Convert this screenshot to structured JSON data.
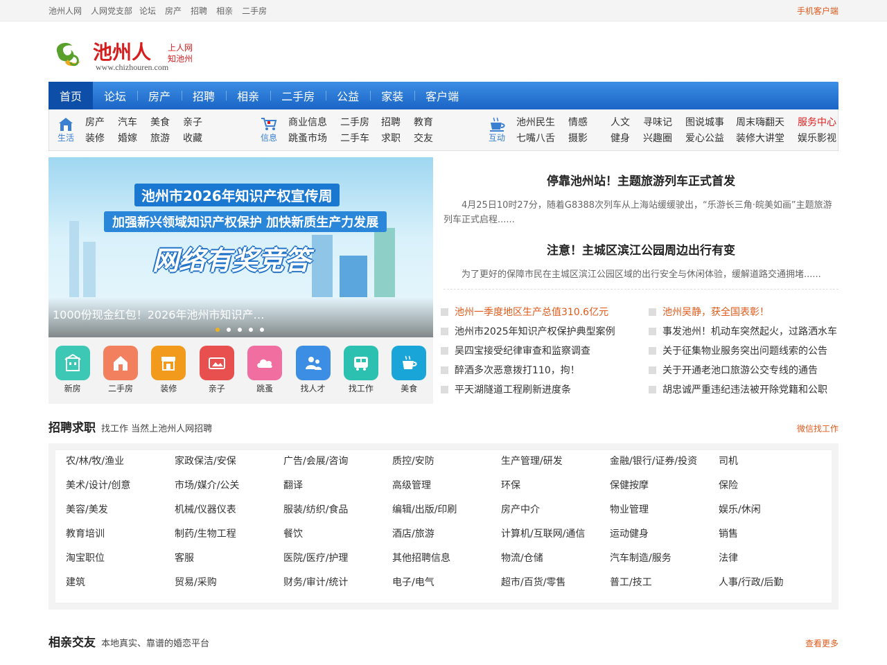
{
  "topbar": {
    "links": [
      "池州人网",
      "人网党支部",
      "论坛",
      "房产",
      "招聘",
      "相亲",
      "二手房"
    ],
    "right": "手机客户端"
  },
  "logo": {
    "name": "池州人",
    "slogan1": "上人网",
    "slogan2": "知池州",
    "url": "www.chizhouren.com"
  },
  "nav": [
    "首页",
    "论坛",
    "房产",
    "招聘",
    "相亲",
    "二手房",
    "公益",
    "家装",
    "客户端"
  ],
  "subnav": {
    "life": {
      "label": "生活",
      "items": [
        "房产",
        "汽车",
        "美食",
        "亲子",
        "装修",
        "婚嫁",
        "旅游",
        "收藏"
      ]
    },
    "info": {
      "label": "信息",
      "items": [
        "商业信息",
        "二手房",
        "招聘",
        "教育",
        "跳蚤市场",
        "二手车",
        "求职",
        "交友"
      ]
    },
    "interact": {
      "label": "互动",
      "items": [
        "池州民生",
        "情感",
        "人文",
        "寻味记",
        "图说城事",
        "周末嗨翻天",
        "服务中心",
        "七嘴八舌",
        "摄影",
        "健身",
        "兴趣圈",
        "爱心公益",
        "装修大讲堂",
        "娱乐影视"
      ]
    }
  },
  "slider": {
    "banner_title": "池州市2026年知识产权宣传周",
    "banner_sub": "加强新兴领域知识产权保护  加快新质生产力发展",
    "banner_big": "网络有奖竞答",
    "caption": "1000份现金红包！2026年池州市知识产…"
  },
  "quick": [
    "新房",
    "二手房",
    "装修",
    "亲子",
    "跳蚤",
    "找人才",
    "找工作",
    "美食"
  ],
  "headlines": [
    {
      "title": "停靠池州站！主题旅游列车正式首发",
      "summary": "4月25日10时27分，随着G8388次列车从上海站缓缓驶出，“乐游长三角·皖美如画”主题旅游列车正式启程......"
    },
    {
      "title": "注意！主城区滨江公园周边出行有变",
      "summary": "为了更好的保障市民在主城区滨江公园区域的出行安全与休闲体验，缓解道路交通拥堵......"
    }
  ],
  "newslist": [
    {
      "text": "池州一季度地区生产总值310.6亿元",
      "hot": true
    },
    {
      "text": "池州吴静，获全国表彰！",
      "hot": true
    },
    {
      "text": "池州市2025年知识产权保护典型案例",
      "hot": false
    },
    {
      "text": "事发池州！机动车突然起火，过路洒水车",
      "hot": false
    },
    {
      "text": "吴四宝接受纪律审查和监察调查",
      "hot": false
    },
    {
      "text": "关于征集物业服务突出问题线索的公告",
      "hot": false
    },
    {
      "text": "醉酒多次恶意拨打110，拘！",
      "hot": false
    },
    {
      "text": "关于开通老池口旅游公交专线的通告",
      "hot": false
    },
    {
      "text": "平天湖隧道工程刷新进度条",
      "hot": false
    },
    {
      "text": "胡忠诚严重违纪违法被开除党籍和公职",
      "hot": false
    }
  ],
  "jobs_section": {
    "title": "招聘求职",
    "subtitle": "找工作 当然上池州人网招聘",
    "more": "微信找工作"
  },
  "jobs": [
    "农/林/牧/渔业",
    "家政保洁/安保",
    "广告/会展/咨询",
    "质控/安防",
    "生产管理/研发",
    "金融/银行/证券/投资",
    "司机",
    "美术/设计/创意",
    "市场/媒介/公关",
    "翻译",
    "高级管理",
    "环保",
    "保健按摩",
    "保险",
    "美容/美发",
    "机械/仪器仪表",
    "服装/纺织/食品",
    "编辑/出版/印刷",
    "房产中介",
    "物业管理",
    "娱乐/休闲",
    "教育培训",
    "制药/生物工程",
    "餐饮",
    "酒店/旅游",
    "计算机/互联网/通信",
    "运动健身",
    "销售",
    "淘宝职位",
    "客服",
    "医院/医疗/护理",
    "其他招聘信息",
    "物流/仓储",
    "汽车制造/服务",
    "法律",
    "建筑",
    "贸易/采购",
    "财务/审计/统计",
    "电子/电气",
    "超市/百货/零售",
    "普工/技工",
    "人事/行政/后勤"
  ],
  "dating_section": {
    "title": "相亲交友",
    "subtitle": "本地真实、靠谱的婚恋平台",
    "more": "查看更多"
  },
  "colors": {
    "accent": "#1a64c6",
    "highlight": "#e05a1b",
    "red": "#e02020"
  }
}
